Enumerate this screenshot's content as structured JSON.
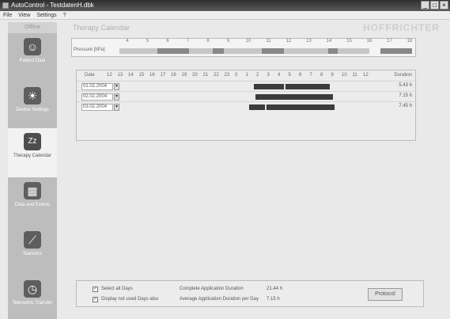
{
  "window": {
    "title": "AutoControl - TestdatenH.dbk",
    "buttons": [
      "_",
      "□",
      "×"
    ]
  },
  "menu": [
    "File",
    "View",
    "Settings",
    "?"
  ],
  "sidebar": {
    "header": "Offline",
    "items": [
      {
        "label": "Patient Data",
        "icon": "patient-face-icon",
        "glyph": "☺",
        "active": false
      },
      {
        "label": "Device Settings",
        "icon": "sun-icon",
        "glyph": "☀",
        "active": false
      },
      {
        "label": "Therapy Calendar",
        "icon": "sleep-icon",
        "glyph": "Zz",
        "active": true
      },
      {
        "label": "Data and Events",
        "icon": "grid-icon",
        "glyph": "▦",
        "active": false
      },
      {
        "label": "Statistics",
        "icon": "trend-chart-icon",
        "glyph": "⟋",
        "active": false
      },
      {
        "label": "Telemetric Transfer",
        "icon": "clock-icon",
        "glyph": "◷",
        "active": false
      }
    ]
  },
  "main": {
    "title": "Therapy Calendar",
    "brand": "HOFFRICHTER",
    "pressure": {
      "label": "Pressure [hPa]",
      "hours": [
        "4",
        "5",
        "6",
        "7",
        "8",
        "9",
        "10",
        "11",
        "12",
        "13",
        "14",
        "15",
        "16",
        "17",
        "18"
      ]
    },
    "calendar": {
      "date_header": "Date",
      "duration_header": "Duration",
      "hour_headers": [
        "12",
        "13",
        "14",
        "15",
        "16",
        "17",
        "18",
        "19",
        "20",
        "21",
        "22",
        "23",
        "0",
        "1",
        "2",
        "3",
        "4",
        "5",
        "6",
        "7",
        "8",
        "9",
        "10",
        "11",
        "12"
      ],
      "rows": [
        {
          "date": "01.02.2004",
          "duration": "5.43 h"
        },
        {
          "date": "02.02.2004",
          "duration": "7.15 h"
        },
        {
          "date": "03.02.2004",
          "duration": "7.45 h"
        }
      ]
    }
  },
  "footer": {
    "select_all": "Select all Days",
    "display_unused": "Display not used Days also",
    "complete_label": "Complete Application Duration",
    "complete_value": "21.44 h",
    "average_label": "Average Application Duration per Day",
    "average_value": "7.15 h",
    "print_label": "Protocol"
  }
}
